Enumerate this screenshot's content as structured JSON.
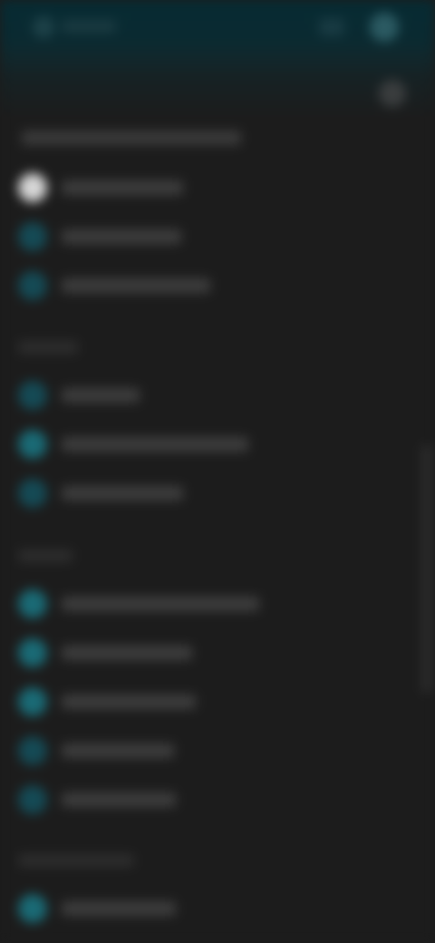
{
  "topbar": {
    "left_icon": "app-icon",
    "left_label": "",
    "right_icon": "notification-icon",
    "avatar_icon": "avatar-icon"
  },
  "panel": {
    "close_icon": "close-icon",
    "header": ""
  },
  "groups": [
    {
      "label": "",
      "items": [
        {
          "label": "",
          "icon": "profile-icon",
          "color": "#cfcfcf"
        },
        {
          "label": "",
          "icon": "item-icon",
          "color": "#154a55"
        },
        {
          "label": "",
          "icon": "item-icon",
          "color": "#154a55"
        }
      ]
    },
    {
      "label": "",
      "items": [
        {
          "label": "",
          "icon": "item-icon",
          "color": "#154a55"
        },
        {
          "label": "",
          "icon": "item-icon",
          "color": "#1a6a75"
        },
        {
          "label": "",
          "icon": "item-icon",
          "color": "#154a55"
        }
      ]
    },
    {
      "label": "",
      "items": [
        {
          "label": "",
          "icon": "item-icon",
          "color": "#1a6a75"
        },
        {
          "label": "",
          "icon": "item-icon",
          "color": "#1a6a75"
        },
        {
          "label": "",
          "icon": "item-icon",
          "color": "#1a6a75"
        },
        {
          "label": "",
          "icon": "item-icon",
          "color": "#154a55"
        },
        {
          "label": "",
          "icon": "item-icon",
          "color": "#154a55"
        }
      ]
    },
    {
      "label": "",
      "items": [
        {
          "label": "",
          "icon": "item-icon",
          "color": "#1a6a75"
        }
      ]
    }
  ],
  "colors": {
    "background": "#1c1c1c",
    "topbar": "#072b33",
    "accent": "#1a6a75"
  }
}
